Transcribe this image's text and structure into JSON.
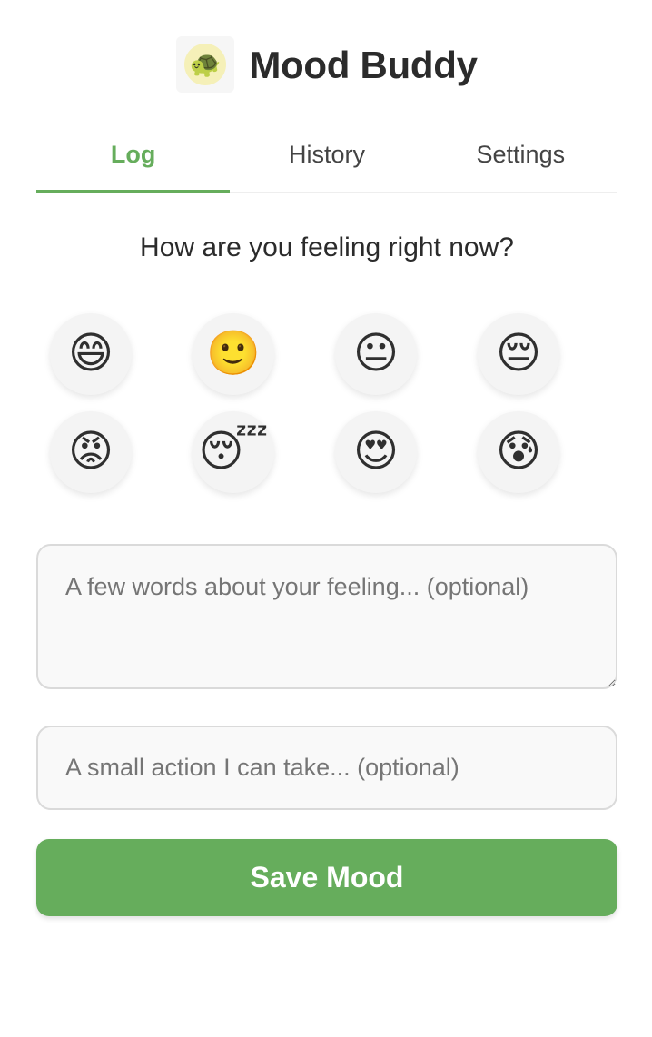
{
  "header": {
    "logo_icon": "🐢",
    "title": "Mood Buddy"
  },
  "tabs": [
    {
      "label": "Log",
      "active": true
    },
    {
      "label": "History",
      "active": false
    },
    {
      "label": "Settings",
      "active": false
    }
  ],
  "log": {
    "question": "How are you feeling right now?",
    "moods": [
      {
        "name": "grinning-face-icon",
        "glyph": "😄"
      },
      {
        "name": "slightly-smiling-face-icon",
        "glyph": "🙂"
      },
      {
        "name": "neutral-face-icon",
        "glyph": "😐"
      },
      {
        "name": "pensive-face-icon",
        "glyph": "😔"
      },
      {
        "name": "angry-face-icon",
        "glyph": "😡"
      },
      {
        "name": "sleeping-face-icon",
        "glyph": "😴"
      },
      {
        "name": "heart-eyes-face-icon",
        "glyph": "😍"
      },
      {
        "name": "anxious-face-icon",
        "glyph": "😰"
      }
    ],
    "feeling_placeholder": "A few words about your feeling... (optional)",
    "feeling_value": "",
    "action_placeholder": "A small action I can take... (optional)",
    "action_value": "",
    "save_label": "Save Mood"
  },
  "colors": {
    "accent": "#66ad5c",
    "input_border": "#dadada",
    "input_bg": "#f9f9f9"
  }
}
